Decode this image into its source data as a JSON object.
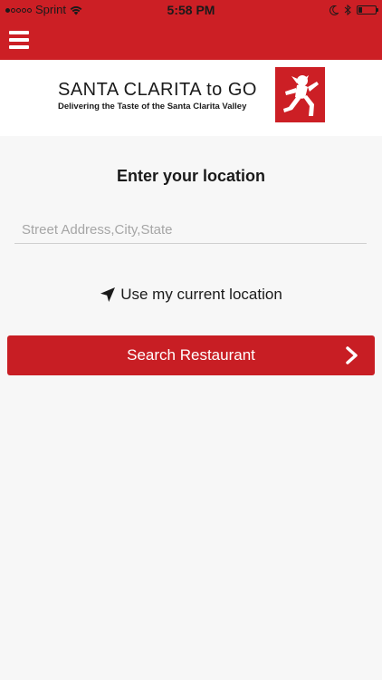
{
  "status_bar": {
    "carrier": "Sprint",
    "time": "5:58 PM",
    "signal_strength": 1,
    "signal_max": 5,
    "battery_level": 0.2
  },
  "nav": {
    "menu_icon": "hamburger-menu-icon"
  },
  "logo": {
    "title": "SANTA CLARITA to GO",
    "tagline": "Delivering the Taste of the Santa Clarita Valley"
  },
  "main": {
    "title": "Enter your location",
    "address_placeholder": "Street Address,City,State",
    "address_value": "",
    "current_location_label": "Use my current location",
    "current_location_icon": "location-arrow-icon",
    "search_button_label": "Search Restaurant",
    "search_button_icon": "chevron-right-icon"
  },
  "colors": {
    "brand_red": "#cc1f25",
    "button_red": "#c81e24",
    "background": "#f7f7f7"
  }
}
